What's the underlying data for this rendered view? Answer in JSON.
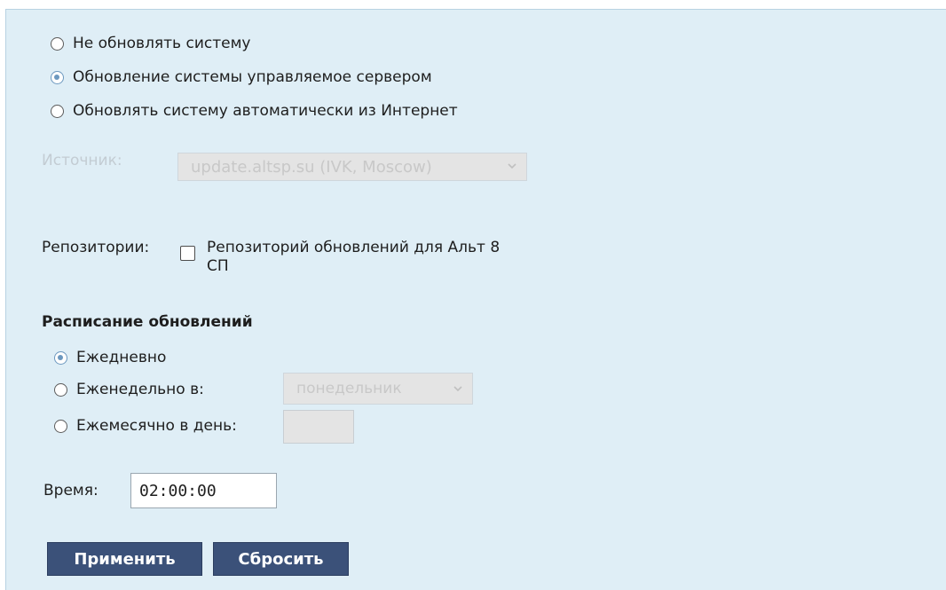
{
  "update_mode": {
    "options": [
      {
        "label": "Не обновлять систему",
        "checked": false
      },
      {
        "label": "Обновление системы управляемое сервером",
        "checked": true
      },
      {
        "label": "Обновлять систему автоматически из Интернет",
        "checked": false
      }
    ]
  },
  "source": {
    "label": "Источник:",
    "value": "update.altsp.su (IVK, Moscow)"
  },
  "repositories": {
    "label": "Репозитории:",
    "item_line1": "Репозиторий обновлений для Альт 8",
    "item_line2": "СП",
    "checked": false
  },
  "schedule": {
    "heading": "Расписание обновлений",
    "daily_label": "Ежедневно",
    "weekly_label": "Еженедельно в:",
    "weekly_day": "понедельник",
    "monthly_label": "Ежемесячно в день:",
    "monthly_value": "",
    "selected": "daily"
  },
  "time": {
    "label": "Время:",
    "value": "02:00:00"
  },
  "buttons": {
    "apply": "Применить",
    "reset": "Сбросить"
  },
  "colors": {
    "panel_bg": "#dfeef6",
    "button_bg": "#3b5179",
    "radio_accent": "#6c98bf"
  }
}
